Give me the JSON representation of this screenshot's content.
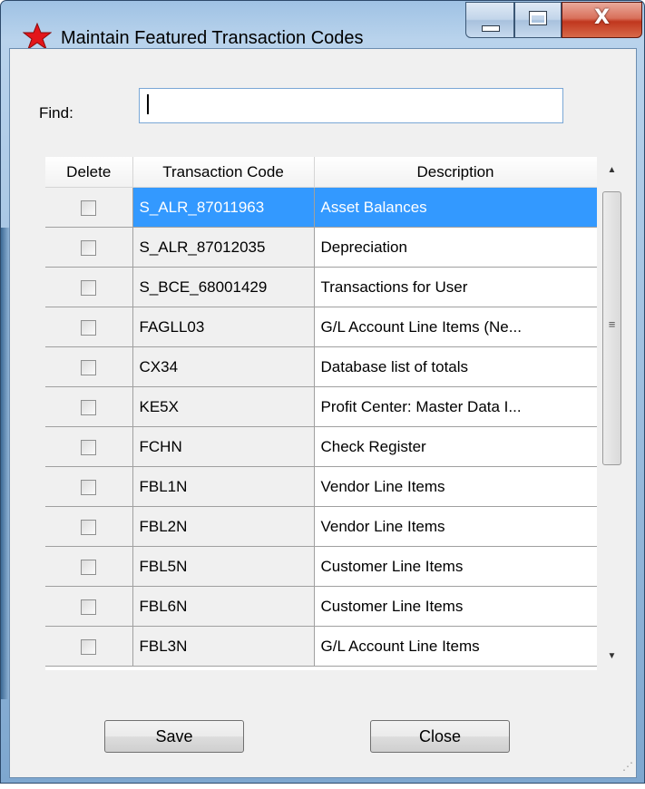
{
  "window": {
    "title": "Maintain Featured Transaction Codes",
    "close_glyph": "X"
  },
  "find": {
    "label": "Find:",
    "value": ""
  },
  "grid": {
    "columns": [
      "Delete",
      "Transaction Code",
      "Description"
    ],
    "rows": [
      {
        "code": "S_ALR_87011963",
        "description": "Asset Balances",
        "selected": true
      },
      {
        "code": "S_ALR_87012035",
        "description": "Depreciation",
        "selected": false
      },
      {
        "code": "S_BCE_68001429",
        "description": "Transactions for User",
        "selected": false
      },
      {
        "code": "FAGLL03",
        "description": "G/L Account Line Items (Ne...",
        "selected": false
      },
      {
        "code": "CX34",
        "description": "Database list of totals",
        "selected": false
      },
      {
        "code": "KE5X",
        "description": "Profit Center: Master Data I...",
        "selected": false
      },
      {
        "code": "FCHN",
        "description": "Check Register",
        "selected": false
      },
      {
        "code": "FBL1N",
        "description": "Vendor Line Items",
        "selected": false
      },
      {
        "code": "FBL2N",
        "description": "Vendor Line Items",
        "selected": false
      },
      {
        "code": "FBL5N",
        "description": "Customer Line Items",
        "selected": false
      },
      {
        "code": "FBL6N",
        "description": "Customer Line Items",
        "selected": false
      },
      {
        "code": "FBL3N",
        "description": "G/L Account Line Items",
        "selected": false
      }
    ]
  },
  "buttons": {
    "save": "Save",
    "close": "Close"
  },
  "colors": {
    "selection": "#3399ff",
    "title_close": "#c0361e",
    "client_bg": "#f0f0f0"
  },
  "icons": {
    "app": "red-star-icon"
  }
}
